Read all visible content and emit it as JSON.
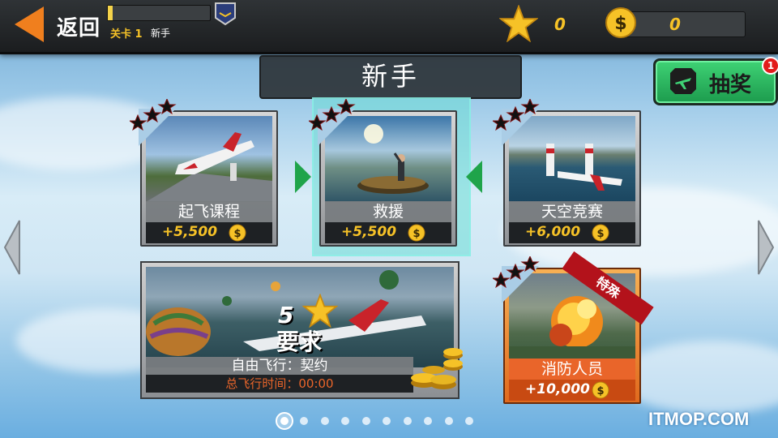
{
  "header": {
    "back_label": "返回",
    "level_text": "关卡 1",
    "level_name": "新手",
    "level_progress": 0.05,
    "stars_count": "0",
    "coins_count": "0"
  },
  "page_title": "新手",
  "lottery": {
    "label": "抽奖",
    "badge": "1"
  },
  "missions": [
    {
      "name": "起飞课程",
      "reward": "+5,500",
      "stars": 3,
      "selected": false
    },
    {
      "name": "救援",
      "reward": "+5,500",
      "stars": 3,
      "selected": true
    },
    {
      "name": "天空竞赛",
      "reward": "+6,000",
      "stars": 3,
      "selected": false
    }
  ],
  "free_flight": {
    "required_stars": "5",
    "required_label": "要求",
    "name": "自由飞行：契约",
    "time_label": "总飞行时间：00:00"
  },
  "special": {
    "ribbon": "特殊",
    "name": "消防人员",
    "reward": "+10,000",
    "stars": 3
  },
  "pagination": {
    "total": 10,
    "current": 1
  },
  "watermark": "ITMOP.COM",
  "colors": {
    "accent_orange": "#f07f1e",
    "gold": "#f6c227",
    "lottery_green": "#1c9b4d",
    "special_orange": "#e9652a",
    "selected_arrow_green": "#1fa44a"
  },
  "icons": [
    "back-arrow-icon",
    "rank-badge-icon",
    "star-icon",
    "coin-icon",
    "lottery-plane-icon",
    "nav-left-icon",
    "nav-right-icon",
    "coin-pile-icon"
  ]
}
